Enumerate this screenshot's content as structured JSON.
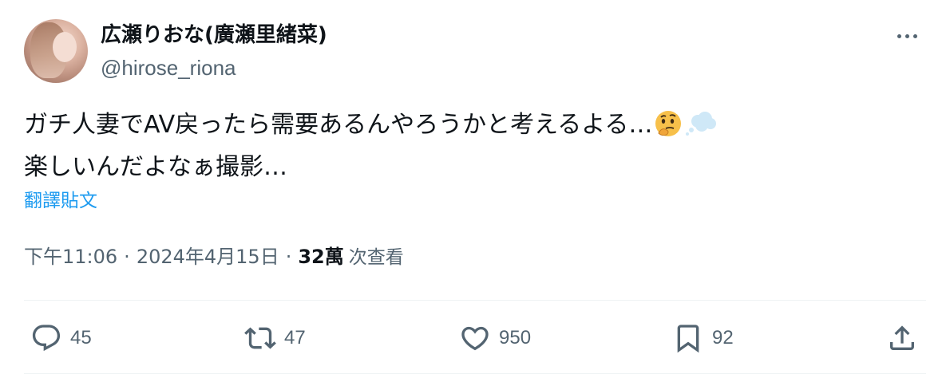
{
  "author": {
    "display_name": "広瀬りおな(廣瀬里緒菜)",
    "handle": "@hirose_riona"
  },
  "tweet": {
    "line1": "ガチ人妻でAV戻ったら需要あるんやろうかと考えるよる…",
    "line2": "楽しいんだよなぁ撮影…",
    "emojis": [
      "thinking-face",
      "thought-balloon"
    ],
    "translate_label": "翻譯貼文"
  },
  "meta": {
    "time": "下午11:06",
    "separator": "·",
    "date": "2024年4月15日",
    "views_count": "32萬",
    "views_label": "次查看"
  },
  "actions": {
    "reply_count": "45",
    "retweet_count": "47",
    "like_count": "950",
    "bookmark_count": "92"
  },
  "icons": {
    "more": "more-horizontal-icon",
    "reply": "reply-icon",
    "retweet": "retweet-icon",
    "like": "heart-icon",
    "bookmark": "bookmark-icon",
    "share": "share-icon"
  },
  "colors": {
    "text": "#0f1419",
    "secondary": "#536471",
    "link": "#1d9bf0",
    "divider": "#eff3f4"
  }
}
